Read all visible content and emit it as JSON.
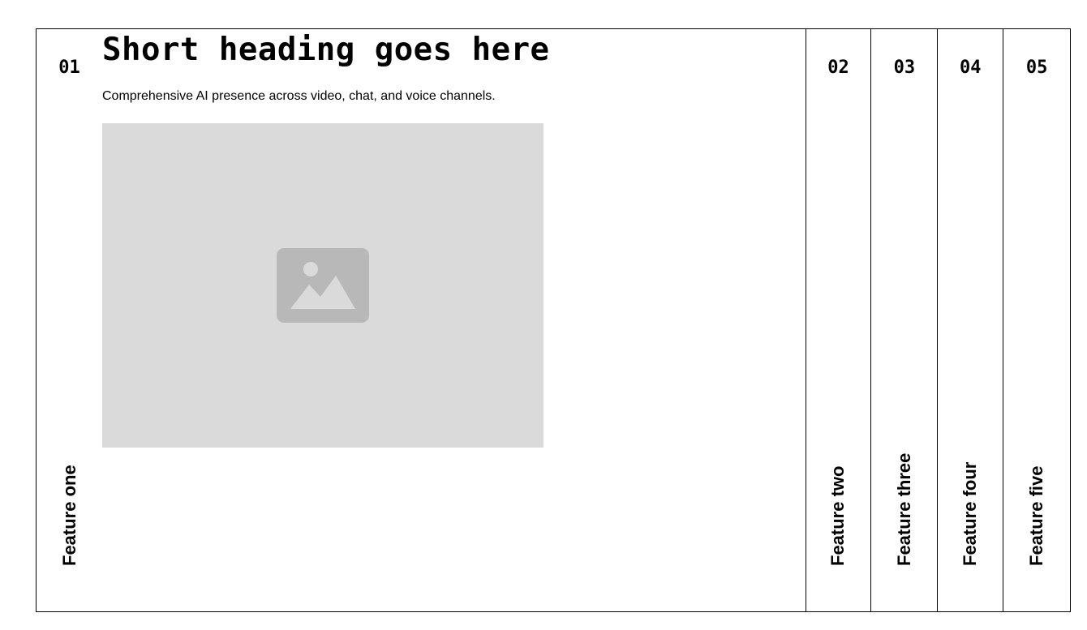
{
  "features": [
    {
      "number": "01",
      "label": "Feature one",
      "heading": "Short heading goes here",
      "description": "Comprehensive AI presence across video, chat, and voice channels.",
      "image_icon": "image-placeholder-icon"
    },
    {
      "number": "02",
      "label": "Feature two"
    },
    {
      "number": "03",
      "label": "Feature three"
    },
    {
      "number": "04",
      "label": "Feature four"
    },
    {
      "number": "05",
      "label": "Feature five"
    }
  ],
  "colors": {
    "border": "#000000",
    "placeholder_bg": "#dadada",
    "placeholder_icon": "#b8b8b8"
  }
}
